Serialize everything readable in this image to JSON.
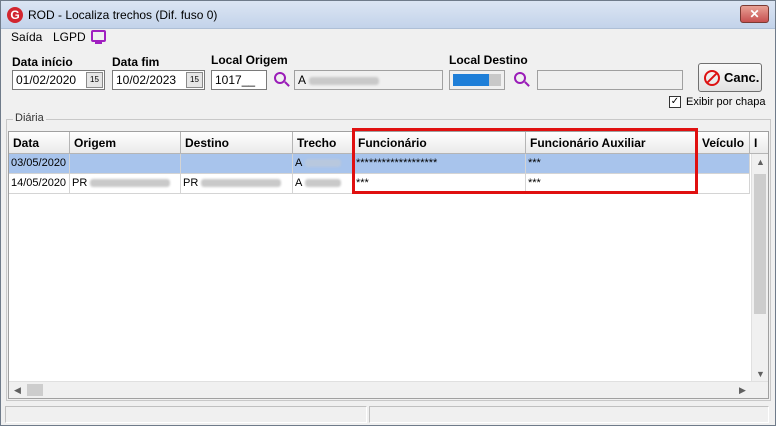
{
  "window": {
    "title": "ROD - Localiza trechos (Dif. fuso 0)",
    "close_label": "✕"
  },
  "app_icon": "app-logo-icon",
  "menu": {
    "saida": "Saída",
    "lgpd": "LGPD"
  },
  "filters": {
    "data_inicio_label": "Data início",
    "data_inicio_value": "01/02/2020",
    "data_fim_label": "Data fim",
    "data_fim_value": "10/02/2023",
    "calendar_btn": "15",
    "local_origem_label": "Local Origem",
    "local_origem_code": "1017__",
    "local_origem_desc": "A",
    "local_destino_label": "Local Destino",
    "local_destino_desc": ""
  },
  "cancel_button": {
    "label": "Canc."
  },
  "exibir_por_chapa": {
    "label": "Exibir por chapa",
    "checked": true,
    "check_glyph": "✓"
  },
  "group_label": "Diária",
  "grid": {
    "columns": [
      "Data",
      "Origem",
      "Destino",
      "Trecho",
      "Funcionário",
      "Funcionário Auxiliar",
      "Veículo",
      "I"
    ],
    "rows": [
      {
        "data": "03/05/2020",
        "origem": "",
        "destino": "",
        "trecho": "A",
        "funcionario": "*******************",
        "auxiliar": "***",
        "veiculo": "",
        "selected": true
      },
      {
        "data": "14/05/2020",
        "origem": "PR",
        "destino": "PR",
        "trecho": "A",
        "funcionario": "***",
        "auxiliar": "***",
        "veiculo": "",
        "selected": false
      }
    ]
  },
  "scroll": {
    "up": "▲",
    "down": "▼",
    "left": "◀",
    "right": "▶"
  },
  "colors": {
    "highlight": "#e01010",
    "selection": "#a8c4ec",
    "accent": "#9a1cb8"
  }
}
